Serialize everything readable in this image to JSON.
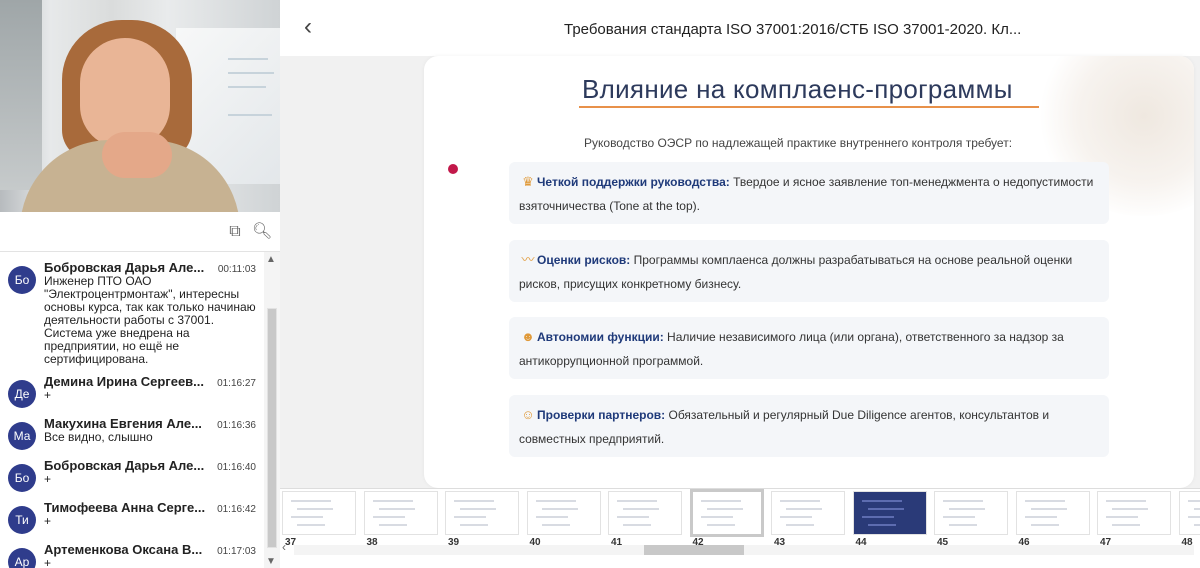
{
  "header": {
    "title": "Требования стандарта ISO 37001:2016/СТБ ISO 37001-2020. Кл...",
    "back_icon": "‹"
  },
  "slide": {
    "title": "Влияние на комплаенс-программы",
    "subtitle": "Руководство ОЭСР по надлежащей практике внутреннего контроля требует:",
    "items": [
      {
        "icon": "crown-icon",
        "glyph": "♛",
        "heading": "Четкой поддержки руководства:",
        "text": " Твердое и ясное заявление топ-менеджмента о недопустимости взяточничества (Tone at the top)."
      },
      {
        "icon": "chart-line-icon",
        "glyph": "⟋",
        "heading": "Оценки рисков:",
        "text": " Программы комплаенса должны разрабатываться на основе реальной оценки рисков, присущих конкретному бизнесу."
      },
      {
        "icon": "people-icon",
        "glyph": "👥",
        "heading": "Автономии функции:",
        "text": " Наличие независимого лица (или органа), ответственного за надзор за антикоррупционной программой."
      },
      {
        "icon": "user-check-icon",
        "glyph": "👤",
        "heading": "Проверки партнеров:",
        "text": " Обязательный и регулярный Due Diligence агентов, консультантов и совместных предприятий."
      }
    ]
  },
  "chat": {
    "messages": [
      {
        "initials": "Бо",
        "name": "Бобровская Дарья Але...",
        "time": "00:11:03",
        "text": "Инженер ПТО ОАО \"Электроцентрмонтаж\", интересны основы курса, так как только начинаю деятельности работы с 37001. Система уже внедрена на предприятии, но ещё не сертифицирована."
      },
      {
        "initials": "Де",
        "name": "Демина Ирина Сергеев...",
        "time": "01:16:27",
        "text": "+"
      },
      {
        "initials": "Ма",
        "name": "Макухина Евгения Але...",
        "time": "01:16:36",
        "text": "Все видно, слышно"
      },
      {
        "initials": "Бо",
        "name": "Бобровская Дарья Але...",
        "time": "01:16:40",
        "text": "+"
      },
      {
        "initials": "Ти",
        "name": "Тимофеева Анна Серге...",
        "time": "01:16:42",
        "text": "+"
      },
      {
        "initials": "Ар",
        "name": "Артеменкова Оксана В...",
        "time": "01:17:03",
        "text": "+"
      }
    ]
  },
  "thumbnails": {
    "numbers": [
      "37",
      "38",
      "39",
      "40",
      "41",
      "42",
      "43",
      "44",
      "45",
      "46",
      "47",
      "48"
    ],
    "selected": "42"
  },
  "colors": {
    "accent_underline": "#e8914a",
    "heading_blue": "#1f3a7a",
    "title_color": "#2d3a5c",
    "avatar": "#2f3c8c",
    "dot": "#c2184a"
  }
}
